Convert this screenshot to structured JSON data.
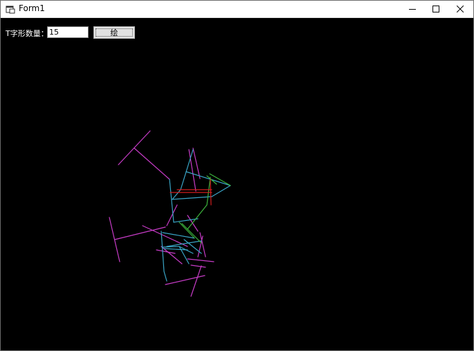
{
  "window": {
    "title": "Form1",
    "icon": "winforms-app-icon",
    "controls": [
      "minimize-icon",
      "maximize-icon",
      "close-icon"
    ]
  },
  "form": {
    "count_label": "T字形数量：",
    "count_value": "15",
    "draw_button_label": "绘"
  },
  "drawing": {
    "background": "#000000",
    "colors": {
      "magenta": "#c83cc8",
      "cyan": "#3aa6c8",
      "green": "#3cb43c",
      "red": "#d21e1e"
    }
  }
}
